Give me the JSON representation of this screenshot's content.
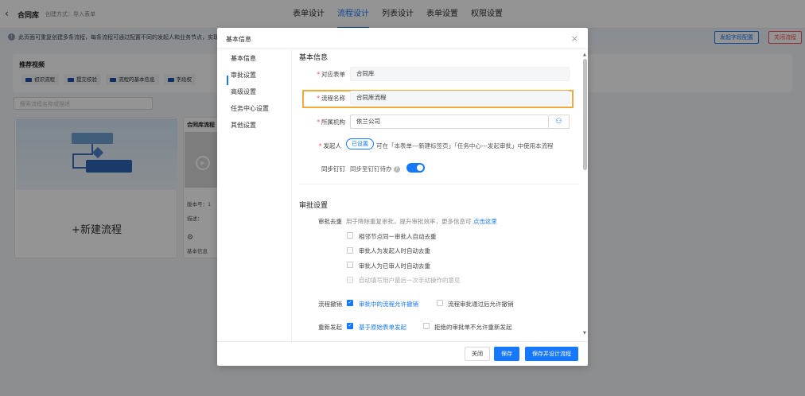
{
  "header": {
    "app_title": "合同库",
    "created_via": "创建方式：导入表单",
    "tabs": [
      "表单设计",
      "流程设计",
      "列表设计",
      "表单设置",
      "权限设置"
    ],
    "active_tab": "流程设计"
  },
  "notice": {
    "text": "此页面可重复创建多条流程，每条流程可通过配置不同的发起人和业务节点，实现",
    "field_config_button": "发起字段配置",
    "close_flow_button": "关闭流程"
  },
  "recommended": {
    "title": "推荐视频",
    "items": [
      "初识流程",
      "提交校验",
      "流程的基本信息",
      "字段权"
    ]
  },
  "search": {
    "placeholder": "搜索流程名称或描述"
  },
  "new_flow_card": {
    "label": "+新建流程"
  },
  "flow_card": {
    "title": "合同库流程",
    "version": "版本号：1",
    "desc": "描述：",
    "basic_info": "基本信息"
  },
  "modal": {
    "title": "基本信息",
    "close_icon": "×",
    "nav": [
      "基本信息",
      "审批设置",
      "高级设置",
      "任务中心设置",
      "其他设置"
    ],
    "basic": {
      "section_title": "基本信息",
      "form_label": "对应表单",
      "form_value": "合同库",
      "name_label": "流程名称",
      "name_value": "合同库流程",
      "org_label": "所属机构",
      "org_value": "依兰公司",
      "initiator_label": "发起人",
      "initiator_tag": "已设置",
      "initiator_hint": "可在「本表单---新建标签页」「任务中心---发起审批」中使用本流程",
      "sync_label": "同步钉钉",
      "sync_text": "同步至钉钉待办"
    },
    "approval": {
      "section_title": "审批设置",
      "dedupe_label": "审批去重",
      "dedupe_hint": "用于降除重复审批，提升审批效率，更多信息可",
      "dedupe_link": "点击这里",
      "dedupe_options": [
        "相邻节点同一审批人自动去重",
        "审批人为发起人时自动去重",
        "审批人为已审人时自动去重",
        "自动填写用户最后一次手动操作的意见"
      ],
      "revoke_label": "流程撤销",
      "revoke_opt1": "审批中的流程允许撤销",
      "revoke_opt2": "流程审批通过后允许撤销",
      "resubmit_label": "重新发起",
      "resubmit_opt1": "基于原始表单发起",
      "resubmit_opt2": "拒绝的审批单不允许重新发起"
    },
    "footer": {
      "close": "关闭",
      "save": "保存",
      "save_design": "保存并设计流程"
    }
  },
  "colors": {
    "accent": "#1677ff",
    "highlight_border": "#f0a93a",
    "required": "#ff4d4f"
  }
}
